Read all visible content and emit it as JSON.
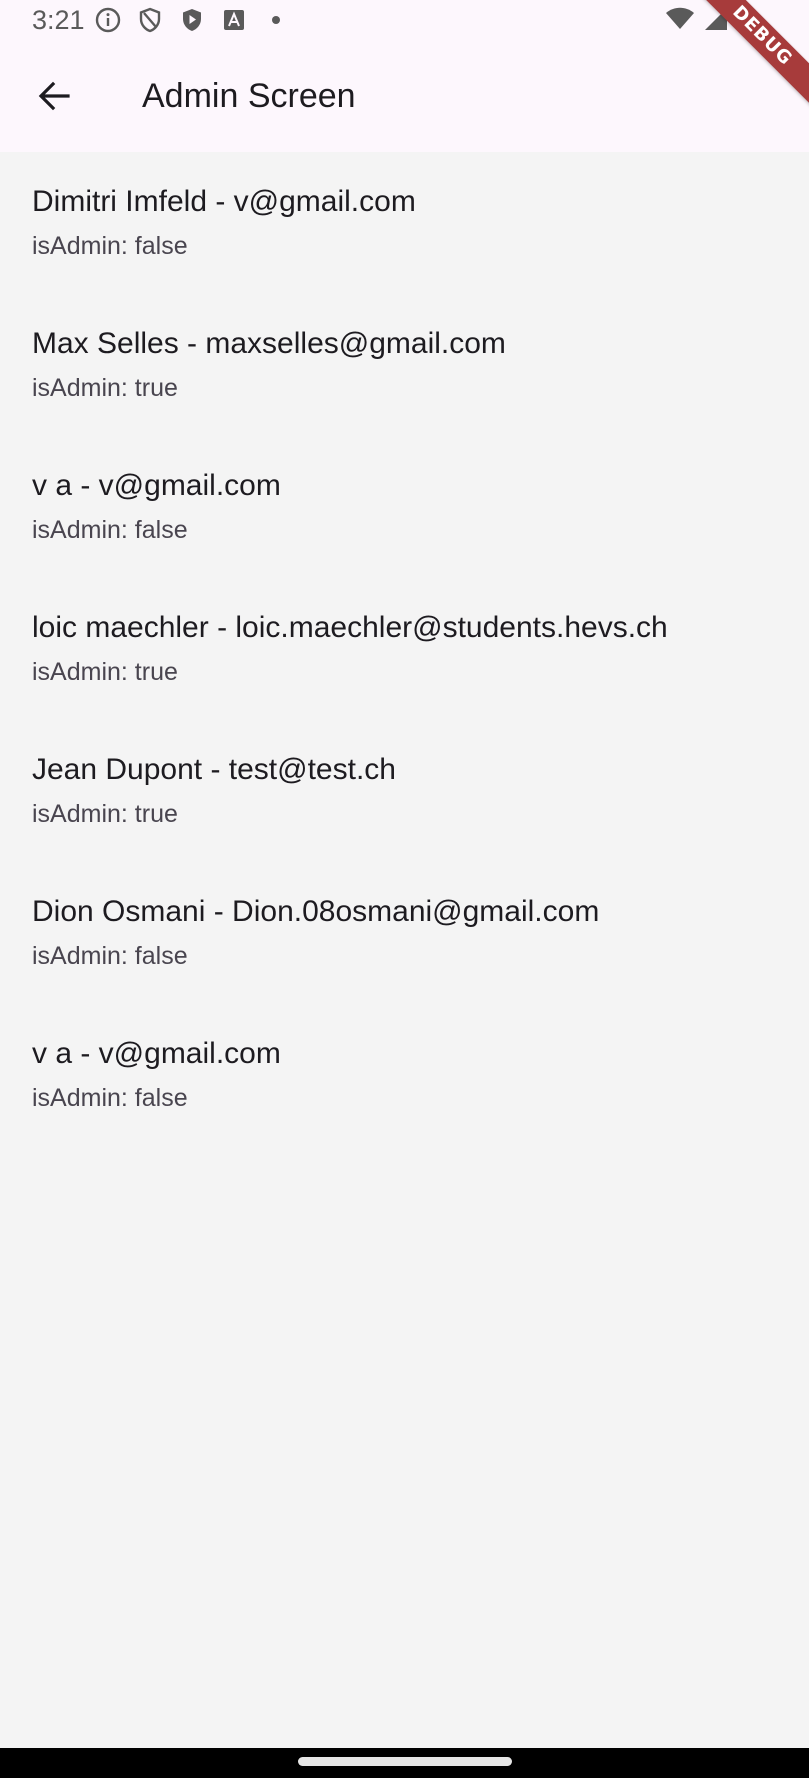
{
  "status_bar": {
    "time": "3:21",
    "icons": [
      "info-circle-icon",
      "shield-icon",
      "play-shield-icon",
      "font-a-icon",
      "dot-icon"
    ],
    "right_icons": [
      "wifi-icon",
      "cell-signal-icon"
    ]
  },
  "app_bar": {
    "back_icon": "arrow-back-icon",
    "title": "Admin Screen"
  },
  "debug_banner": "DEBUG",
  "users": [
    {
      "title": "Dimitri  Imfeld - v@gmail.com",
      "subtitle": "isAdmin: false"
    },
    {
      "title": "Max Selles - maxselles@gmail.com",
      "subtitle": "isAdmin: true"
    },
    {
      "title": "v a - v@gmail.com",
      "subtitle": "isAdmin: false"
    },
    {
      "title": "loic maechler - loic.maechler@students.hevs.ch",
      "subtitle": "isAdmin: true"
    },
    {
      "title": "Jean Dupont - test@test.ch",
      "subtitle": "isAdmin: true"
    },
    {
      "title": "Dion Osmani - Dion.08osmani@gmail.com",
      "subtitle": "isAdmin: false"
    },
    {
      "title": "v a - v@gmail.com",
      "subtitle": "isAdmin: false"
    }
  ]
}
